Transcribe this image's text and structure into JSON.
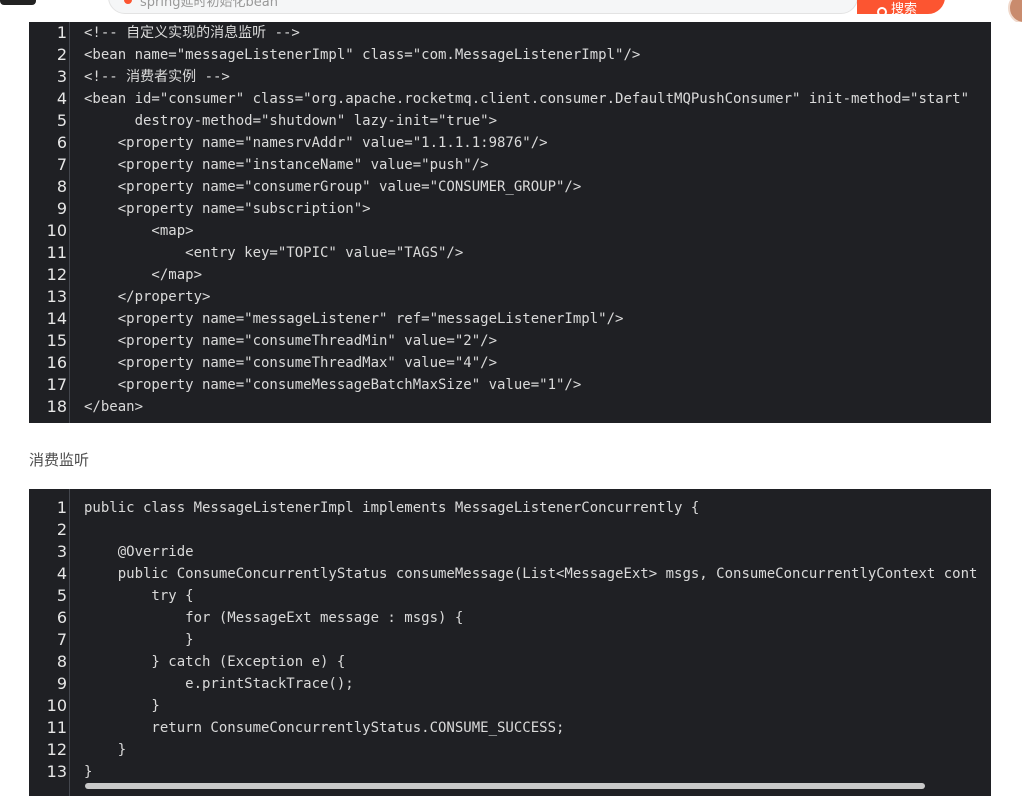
{
  "header": {
    "search_placeholder": "spring延时初始化bean",
    "search_button": "搜索"
  },
  "code_block_1": {
    "lines": [
      "<!-- 自定义实现的消息监听 -->",
      "<bean name=\"messageListenerImpl\" class=\"com.MessageListenerImpl\"/>",
      "<!-- 消费者实例 -->",
      "<bean id=\"consumer\" class=\"org.apache.rocketmq.client.consumer.DefaultMQPushConsumer\" init-method=\"start\"",
      "      destroy-method=\"shutdown\" lazy-init=\"true\">",
      "    <property name=\"namesrvAddr\" value=\"1.1.1.1:9876\"/>",
      "    <property name=\"instanceName\" value=\"push\"/>",
      "    <property name=\"consumerGroup\" value=\"CONSUMER_GROUP\"/>",
      "    <property name=\"subscription\">",
      "        <map>",
      "            <entry key=\"TOPIC\" value=\"TAGS\"/>",
      "        </map>",
      "    </property>",
      "    <property name=\"messageListener\" ref=\"messageListenerImpl\"/>",
      "    <property name=\"consumeThreadMin\" value=\"2\"/>",
      "    <property name=\"consumeThreadMax\" value=\"4\"/>",
      "    <property name=\"consumeMessageBatchMaxSize\" value=\"1\"/>",
      "</bean>"
    ]
  },
  "section_label": "消费监听",
  "code_block_2": {
    "lines": [
      "public class MessageListenerImpl implements MessageListenerConcurrently {",
      "",
      "    @Override",
      "    public ConsumeConcurrentlyStatus consumeMessage(List<MessageExt> msgs, ConsumeConcurrentlyContext cont",
      "        try {",
      "            for (MessageExt message : msgs) {",
      "            }",
      "        } catch (Exception e) {",
      "            e.printStackTrace();",
      "        }",
      "        return ConsumeConcurrentlyStatus.CONSUME_SUCCESS;",
      "    }",
      "}"
    ]
  },
  "colors": {
    "code_background": "#1f2024",
    "code_text": "#dadada",
    "accent": "#fc5531"
  },
  "icons": [
    "fire-icon",
    "search-icon"
  ]
}
